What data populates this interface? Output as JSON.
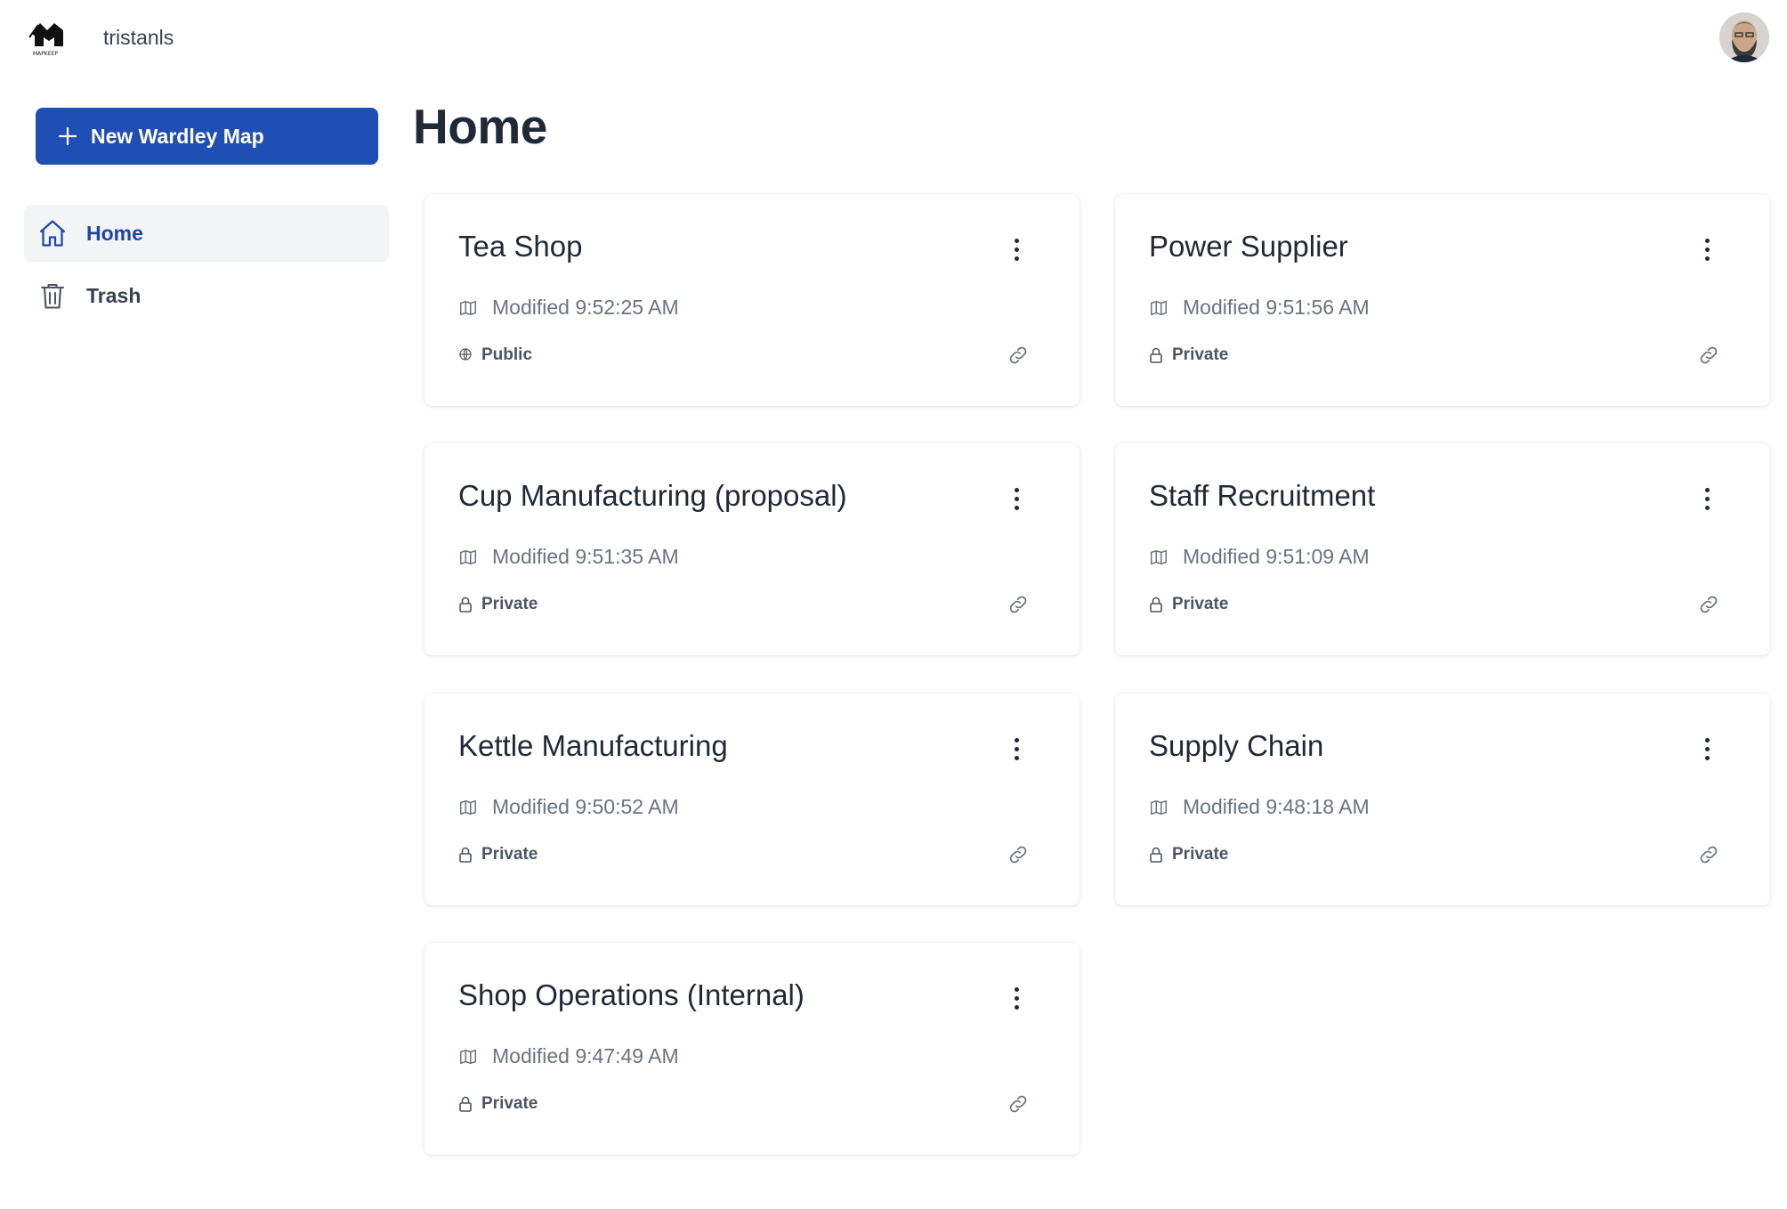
{
  "header": {
    "logo_text": "MAPKEEP",
    "username": "tristanls"
  },
  "sidebar": {
    "new_button_label": "New Wardley Map",
    "items": [
      {
        "label": "Home",
        "icon": "home-icon",
        "active": true
      },
      {
        "label": "Trash",
        "icon": "trash-icon",
        "active": false
      }
    ]
  },
  "main": {
    "title": "Home",
    "maps": [
      {
        "title": "Tea Shop",
        "modified": "Modified 9:52:25 AM",
        "visibility": "Public",
        "visibility_icon": "globe-icon"
      },
      {
        "title": "Power Supplier",
        "modified": "Modified 9:51:56 AM",
        "visibility": "Private",
        "visibility_icon": "lock-icon"
      },
      {
        "title": "Cup Manufacturing (proposal)",
        "modified": "Modified 9:51:35 AM",
        "visibility": "Private",
        "visibility_icon": "lock-icon"
      },
      {
        "title": "Staff Recruitment",
        "modified": "Modified 9:51:09 AM",
        "visibility": "Private",
        "visibility_icon": "lock-icon"
      },
      {
        "title": "Kettle Manufacturing",
        "modified": "Modified 9:50:52 AM",
        "visibility": "Private",
        "visibility_icon": "lock-icon"
      },
      {
        "title": "Supply Chain",
        "modified": "Modified 9:48:18 AM",
        "visibility": "Private",
        "visibility_icon": "lock-icon"
      },
      {
        "title": "Shop Operations (Internal)",
        "modified": "Modified 9:47:49 AM",
        "visibility": "Private",
        "visibility_icon": "lock-icon"
      }
    ]
  },
  "colors": {
    "primary": "#1f4fb4",
    "active_nav_text": "#1e45a8",
    "active_nav_bg": "#f3f4f6",
    "text": "#1f2937",
    "muted": "#6b7280"
  }
}
